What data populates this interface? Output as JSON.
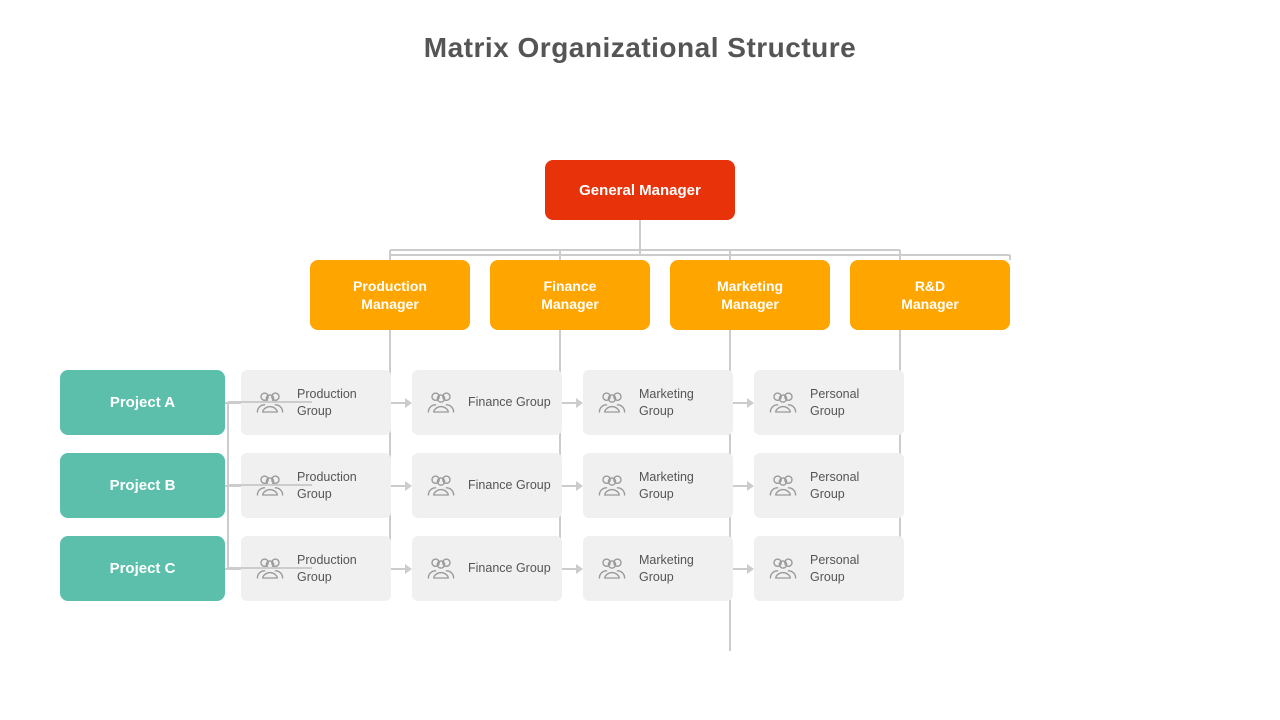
{
  "title": "Matrix Organizational Structure",
  "general_manager": "General Manager",
  "managers": [
    {
      "label": "Production\nManager",
      "id": "production-manager"
    },
    {
      "label": "Finance\nManager",
      "id": "finance-manager"
    },
    {
      "label": "Marketing\nManager",
      "id": "marketing-manager"
    },
    {
      "label": "R&D\nManager",
      "id": "rd-manager"
    }
  ],
  "projects": [
    {
      "label": "Project A",
      "groups": [
        {
          "label": "Production\nGroup"
        },
        {
          "label": "Finance\nGroup"
        },
        {
          "label": "Marketing\nGroup"
        },
        {
          "label": "Personal\nGroup"
        }
      ]
    },
    {
      "label": "Project B",
      "groups": [
        {
          "label": "Production\nGroup"
        },
        {
          "label": "Finance\nGroup"
        },
        {
          "label": "Marketing\nGroup"
        },
        {
          "label": "Personal\nGroup"
        }
      ]
    },
    {
      "label": "Project C",
      "groups": [
        {
          "label": "Production\nGroup"
        },
        {
          "label": "Finance\nGroup"
        },
        {
          "label": "Marketing\nGroup"
        },
        {
          "label": "Personal\nGroup"
        }
      ]
    }
  ],
  "colors": {
    "gm": "#e8320a",
    "manager": "#ffa500",
    "project": "#5cbfab",
    "group_bg": "#f0f0f0",
    "line": "#cccccc"
  }
}
